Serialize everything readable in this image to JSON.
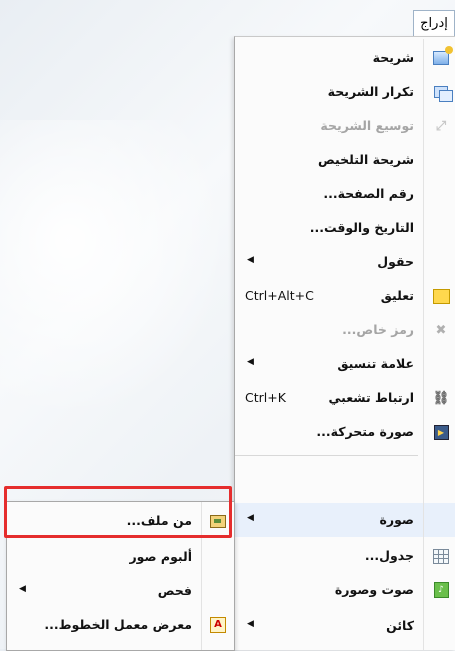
{
  "menubar": {
    "insert_label": "إدراج"
  },
  "main_menu": {
    "items": [
      {
        "label": "شريحة",
        "icon": "new-slide-icon",
        "disabled": false
      },
      {
        "label": "تكرار الشريحة",
        "icon": "duplicate-slide-icon",
        "disabled": false
      },
      {
        "label": "توسيع الشريحة",
        "icon": "expand-slide-icon",
        "disabled": true
      },
      {
        "label": "شريحة التلخيص",
        "icon": "",
        "disabled": false
      },
      {
        "label": "رقم الصفحة...",
        "icon": "",
        "disabled": false
      },
      {
        "label": "التاريخ والوقت...",
        "icon": "",
        "disabled": false
      },
      {
        "label": "حقول",
        "icon": "",
        "disabled": false,
        "submenu": true
      },
      {
        "label": "تعليق",
        "icon": "comment-icon",
        "disabled": false,
        "shortcut": "Ctrl+Alt+C"
      },
      {
        "label": "رمز خاص...",
        "icon": "special-character-icon",
        "disabled": true
      },
      {
        "label": "علامة تنسيق",
        "icon": "",
        "disabled": false,
        "submenu": true
      },
      {
        "label": "ارتباط تشعبي",
        "icon": "hyperlink-icon",
        "disabled": false,
        "shortcut": "Ctrl+K"
      },
      {
        "label": "صورة متحركة...",
        "icon": "animated-image-icon",
        "disabled": false
      },
      {
        "label": "صورة",
        "icon": "",
        "disabled": false,
        "submenu": true,
        "highlighted": true
      },
      {
        "label": "جدول...",
        "icon": "table-icon",
        "disabled": false
      },
      {
        "label": "صوت وصورة",
        "icon": "media-icon",
        "disabled": false
      },
      {
        "label": "كائن",
        "icon": "",
        "disabled": false,
        "submenu": true
      }
    ]
  },
  "image_submenu": {
    "items": [
      {
        "label": "من ملف...",
        "icon": "from-file-icon"
      },
      {
        "label": "ألبوم صور",
        "icon": ""
      },
      {
        "label": "فحص",
        "icon": "",
        "submenu": true
      },
      {
        "label": "معرض معمل الخطوط...",
        "icon": "fontwork-icon"
      }
    ]
  },
  "colors": {
    "highlight_box": "#e52d2d"
  }
}
